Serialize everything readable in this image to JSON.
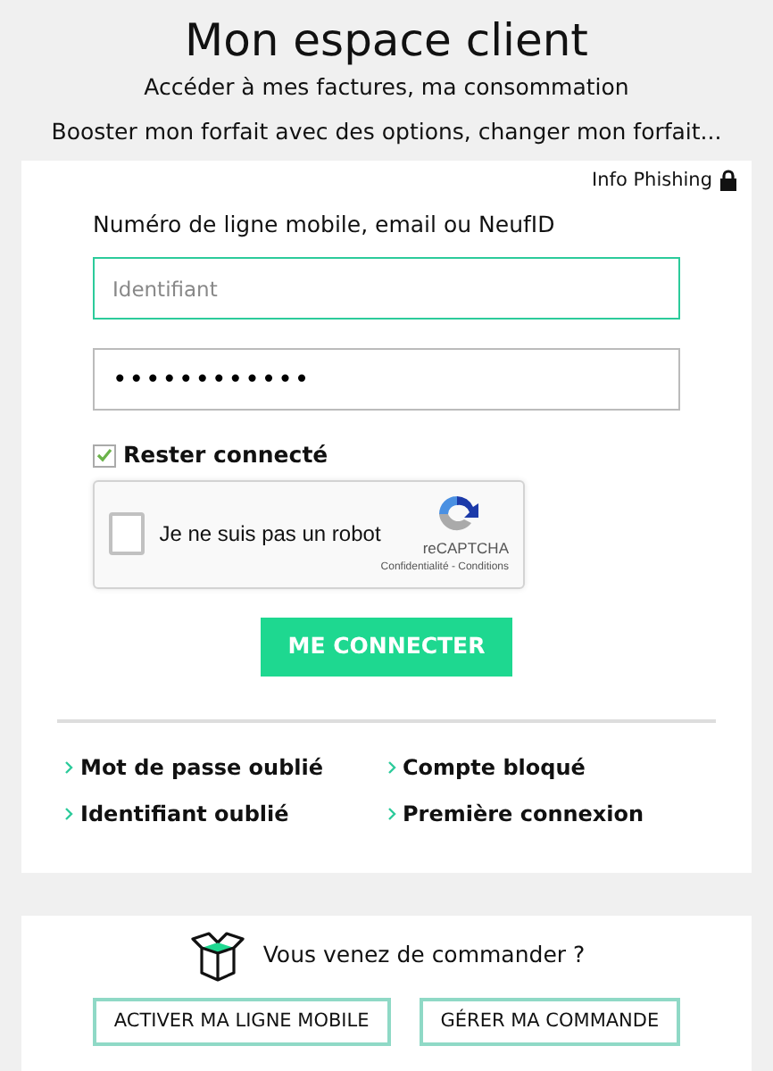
{
  "header": {
    "title": "Mon espace client",
    "lines": [
      "Accéder à mes factures, ma consommation",
      "Booster mon forfait avec des options, changer mon forfait..."
    ]
  },
  "login": {
    "phishing": "Info Phishing",
    "id_label": "Numéro de ligne mobile, email ou NeufID",
    "id_field": {
      "placeholder": "Identifiant",
      "focused": true
    },
    "password_field": {
      "value": "••••••••••••"
    },
    "remember": {
      "label": "Rester connecté",
      "checked": true
    },
    "captcha": {
      "label": "Je ne suis pas un robot",
      "checked": false,
      "brand": "reCAPTCHA",
      "legal": "Confidentialité - Conditions"
    },
    "submit": "ME CONNECTER",
    "links": [
      "Mot de passe oublié",
      "Compte bloqué",
      "Identifiant oublié",
      "Première connexion"
    ]
  },
  "order": {
    "question": "Vous venez de commander ?",
    "buttons": [
      "ACTIVER MA LIGNE MOBILE",
      "GÉRER MA COMMANDE"
    ]
  }
}
